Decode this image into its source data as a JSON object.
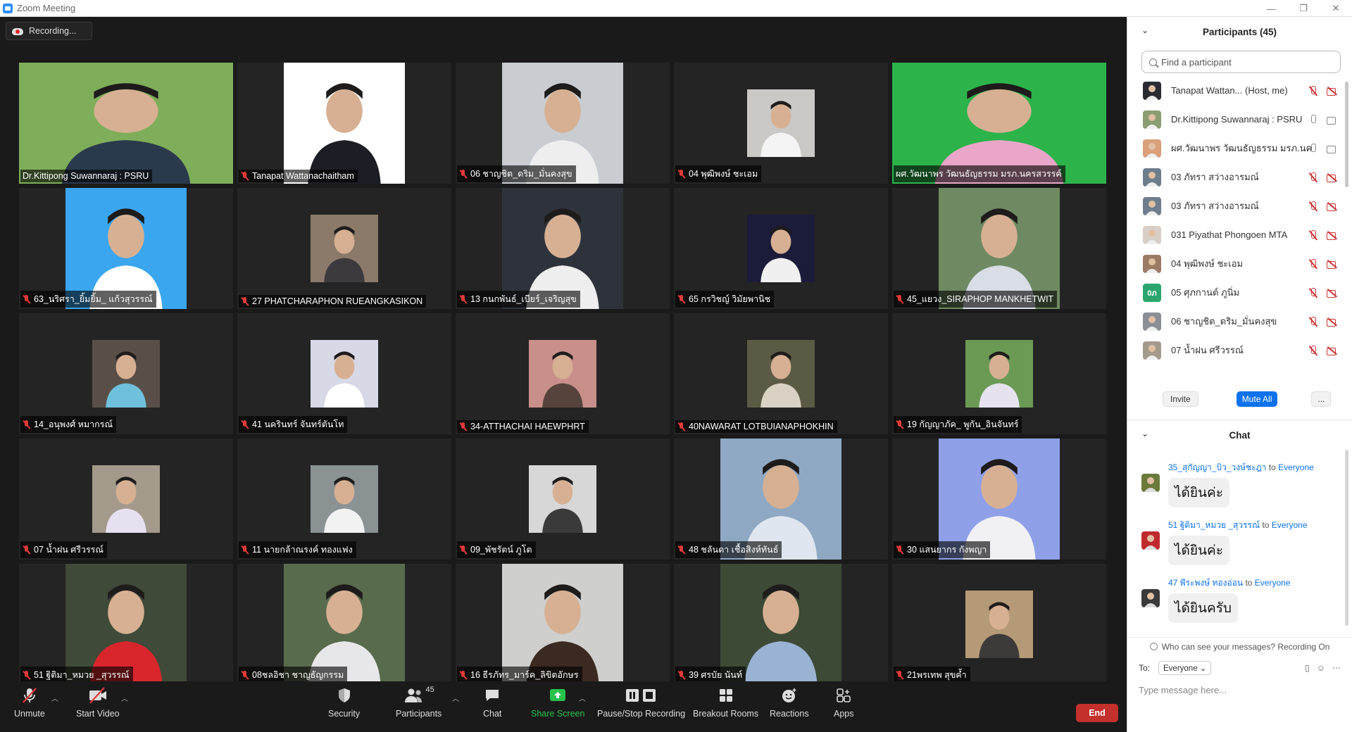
{
  "window": {
    "title": "Zoom Meeting",
    "controls": [
      "—",
      "❐",
      "✕"
    ]
  },
  "recording_badge": "Recording...",
  "tiles": [
    {
      "name": "Dr.Kittipong Suwannaraj : PSRU",
      "muted": false,
      "layout": "full",
      "bg": "#7fae5a",
      "fg": "#2a3a4c",
      "active": false
    },
    {
      "name": "Tanapat Wattanachaitham",
      "muted": true,
      "layout": "mid",
      "bg": "#ffffff",
      "fg": "#1d1d25",
      "active": false
    },
    {
      "name": "06 ชาญชิต_ดริม_มั่นคงสุข",
      "muted": true,
      "layout": "mid",
      "bg": "#c9cdd2",
      "fg": "#eeeeee",
      "active": false
    },
    {
      "name": "04 พุฒิพงษ์ ชะเอม",
      "muted": true,
      "layout": "small",
      "bg": "#cbc9c6",
      "fg": "#f4f4f4",
      "active": false
    },
    {
      "name": "ผศ.วัฒนาพร วัฒนธัญธรรม มรภ.นครสวรรค์",
      "muted": false,
      "layout": "full",
      "bg": "#2cb34a",
      "fg": "#e9a6c8",
      "active": true
    },
    {
      "name": "63_นริศรา_ยิ้มยิ้ม_ แก้วสุวรรณ์",
      "muted": true,
      "layout": "mid",
      "bg": "#3aa6ef",
      "fg": "#ffffff",
      "active": false
    },
    {
      "name": "27 PHATCHARAPHON RUEANGKASIKON",
      "muted": true,
      "layout": "small",
      "bg": "#8b7a6a",
      "fg": "#3c3a3f",
      "active": false
    },
    {
      "name": "13 กนกพันธ์_เบียร์_เจริญสุข",
      "muted": true,
      "layout": "mid",
      "bg": "#2e333b",
      "fg": "#eeeeee",
      "active": false
    },
    {
      "name": "65 กรวิชญ์ วิมัยพานิช",
      "muted": true,
      "layout": "small",
      "bg": "#1b1b3a",
      "fg": "#f0f0f0",
      "active": false
    },
    {
      "name": "45_แยวง_SIRAPHOP MANKHETWIT",
      "muted": true,
      "layout": "mid",
      "bg": "#6f8a62",
      "fg": "#d9dde6",
      "active": false
    },
    {
      "name": "14_อนุพงศ์ หมากรณ์",
      "muted": true,
      "layout": "small",
      "bg": "#5a4f48",
      "fg": "#6fc0da",
      "active": false
    },
    {
      "name": "41 นครินทร์ จันทร์ตันโท",
      "muted": true,
      "layout": "small",
      "bg": "#d7d9e6",
      "fg": "#ffffff",
      "active": false
    },
    {
      "name": "34-ATTHACHAI HAEWPHRT",
      "muted": true,
      "layout": "small",
      "bg": "#c98f8a",
      "fg": "#56443c",
      "active": false
    },
    {
      "name": "40NAWARAT LOTBUIANAPHOKHIN",
      "muted": true,
      "layout": "small",
      "bg": "#5b5a45",
      "fg": "#d9d2c4",
      "active": false
    },
    {
      "name": "19 กัญญาภัค_ พูกัน_อินจันทร์",
      "muted": true,
      "layout": "small",
      "bg": "#6b9a55",
      "fg": "#e6e3ee",
      "active": false
    },
    {
      "name": "07 น้ำฝน ศรีวรรณ์",
      "muted": true,
      "layout": "small",
      "bg": "#a49a8b",
      "fg": "#e6e0f0",
      "active": false
    },
    {
      "name": "11 นายกล้าณรงค์ ทองแฟง",
      "muted": true,
      "layout": "small",
      "bg": "#8a9294",
      "fg": "#f2f2f2",
      "active": false
    },
    {
      "name": "09_พัชรัตน์ ภูโต",
      "muted": true,
      "layout": "small",
      "bg": "#d7d7d7",
      "fg": "#3a3a3a",
      "active": false
    },
    {
      "name": "48 ชลันดา เชื้อสิงห์ทันธ์",
      "muted": true,
      "layout": "mid",
      "bg": "#8fa9c4",
      "fg": "#dfe6ef",
      "active": false
    },
    {
      "name": "30 แสนยากร กังพญา",
      "muted": true,
      "layout": "mid",
      "bg": "#8fa0e8",
      "fg": "#f0f0f5",
      "active": false
    },
    {
      "name": "51 ฐิติมา_หมวย _สุวรรณ์",
      "muted": true,
      "layout": "mid",
      "bg": "#3f4a38",
      "fg": "#d8262c",
      "active": false
    },
    {
      "name": "08ชลอิชา ชาญธัญกรรม",
      "muted": true,
      "layout": "mid",
      "bg": "#596b4d",
      "fg": "#e7e7ea",
      "active": false
    },
    {
      "name": "16 ธีรภัทร_มาร์ค_ลิขิตอักษร",
      "muted": true,
      "layout": "mid",
      "bg": "#cfcfcd",
      "fg": "#3b2a22",
      "active": false
    },
    {
      "name": "39 ศรบัย นันท์",
      "muted": true,
      "layout": "mid",
      "bg": "#3c4a36",
      "fg": "#9bb3d3",
      "active": false
    },
    {
      "name": "21พรเทพ สุขค้ำ",
      "muted": true,
      "layout": "small",
      "bg": "#b49a76",
      "fg": "#3d3a3a",
      "active": false
    }
  ],
  "toolbar": {
    "unmute": "Unmute",
    "start_video": "Start Video",
    "security": "Security",
    "participants": "Participants",
    "participants_count": "45",
    "chat": "Chat",
    "share_screen": "Share Screen",
    "pause_stop_recording": "Pause/Stop Recording",
    "breakout_rooms": "Breakout Rooms",
    "reactions": "Reactions",
    "apps": "Apps",
    "end": "End"
  },
  "participants_panel": {
    "title": "Participants (45)",
    "search_placeholder": "Find a participant",
    "list": [
      {
        "name": "Tanapat Wattan... (Host, me)",
        "mic": "off",
        "cam": "off",
        "avatar": "#2b2b33"
      },
      {
        "name": "Dr.Kittipong Suwannaraj : PSRU",
        "mic": "on",
        "cam": "on",
        "avatar": "#8a9e72"
      },
      {
        "name": "ผศ.วัฒนาพร วัฒนธัญธรรม มรภ.นค...",
        "mic": "on",
        "cam": "on",
        "avatar": "#d9a07a"
      },
      {
        "name": "03 ภัทรา สว่างอารมณ์",
        "mic": "off",
        "cam": "off",
        "avatar": "#6d7d8c"
      },
      {
        "name": "03 ภัทรา สว่างอารมณ์",
        "mic": "off",
        "cam": "off",
        "avatar": "#6d7d8c"
      },
      {
        "name": "031 Piyathat Phongoen MTA",
        "mic": "off",
        "cam": "off",
        "avatar": "#d9cfc7"
      },
      {
        "name": "04 พุฒิพงษ์ ชะเอม",
        "mic": "off",
        "cam": "off",
        "avatar": "#9b7a66"
      },
      {
        "name": "05 ศุภกานต์ ภูนิ่ม",
        "mic": "off",
        "cam": "off",
        "avatar": "green",
        "initials": "0ภ"
      },
      {
        "name": "06 ชาญชิต_ดริม_มั่นคงสุข",
        "mic": "off",
        "cam": "off",
        "avatar": "#8a8f97"
      },
      {
        "name": "07 น้ำฝน ศรีวรรณ์",
        "mic": "off",
        "cam": "off",
        "avatar": "#a49a8b"
      }
    ],
    "invite": "Invite",
    "mute_all": "Mute All",
    "more": "..."
  },
  "chat_panel": {
    "title": "Chat",
    "messages": [
      {
        "sender": "35_สุกัญญา_บิว_วงษ์ชะฎา",
        "to_word": "to",
        "recipient": "Everyone",
        "text": "ได้ยินค่ะ",
        "avatar": "#6b7a3a"
      },
      {
        "sender": "51 ฐิติมา_หมวย _สุวรรณ์",
        "to_word": "to",
        "recipient": "Everyone",
        "text": "ได้ยินค่ะ",
        "avatar": "#c02a2e"
      },
      {
        "sender": "47 พีระพงษ์ ทองอ่อน",
        "to_word": "to",
        "recipient": "Everyone",
        "text": "ได้ยินครับ",
        "avatar": "#3a3a3a"
      }
    ],
    "notice": "Who can see your messages? Recording On",
    "to_label": "To:",
    "to_value": "Everyone",
    "input_placeholder": "Type message here..."
  }
}
